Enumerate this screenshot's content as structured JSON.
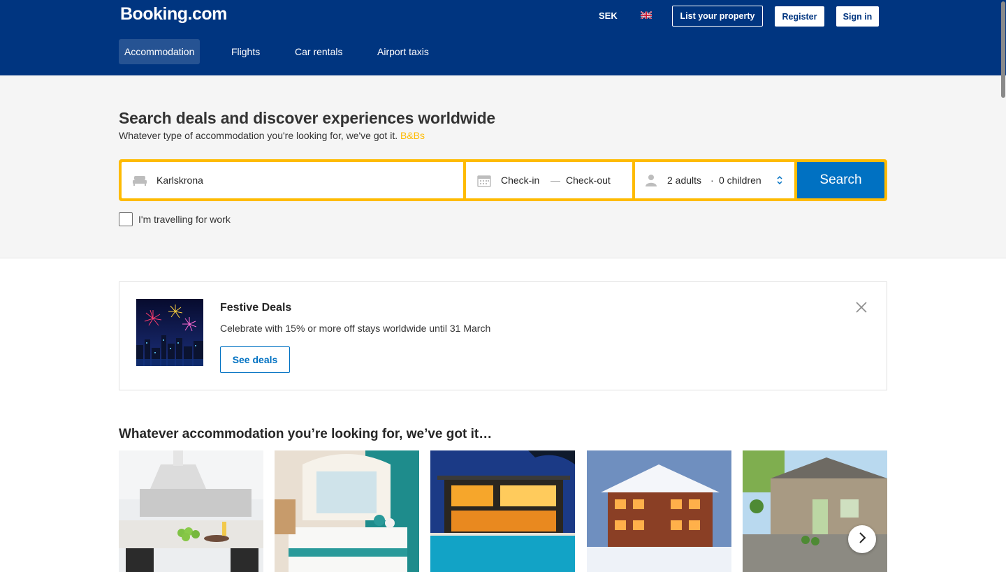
{
  "header": {
    "logo_text": "Booking",
    "logo_suffix": ".com",
    "currency": "SEK",
    "language_flag": "uk-flag-icon",
    "list_property": "List your property",
    "register": "Register",
    "sign_in": "Sign in",
    "nav": [
      {
        "label": "Accommodation",
        "active": true
      },
      {
        "label": "Flights",
        "active": false
      },
      {
        "label": "Car rentals",
        "active": false
      },
      {
        "label": "Airport taxis",
        "active": false
      }
    ]
  },
  "hero": {
    "title": "Search deals and discover experiences worldwide",
    "subtitle": "Whatever type of accommodation you're looking for, we've got it.",
    "subtitle_link": "B&Bs"
  },
  "search": {
    "destination": "Karlskrona",
    "check_in": "Check-in",
    "date_separator": "—",
    "check_out": "Check-out",
    "adults": "2 adults",
    "guest_separator": "·",
    "children": "0 children",
    "button": "Search",
    "work_label": "I'm travelling for work",
    "work_checked": false
  },
  "banner": {
    "title": "Festive Deals",
    "text": "Celebrate with 15% or more off stays worldwide until 31 March",
    "button": "See deals"
  },
  "accommodation": {
    "title": "Whatever accommodation you’re looking for, we’ve got it…",
    "cards": [
      "apartment-kitchen-image",
      "hotel-room-image",
      "villa-pool-image",
      "chalet-snow-image",
      "cottage-garden-image"
    ]
  },
  "colors": {
    "brand": "#003580",
    "accent": "#febb02",
    "primary": "#0071c2"
  }
}
